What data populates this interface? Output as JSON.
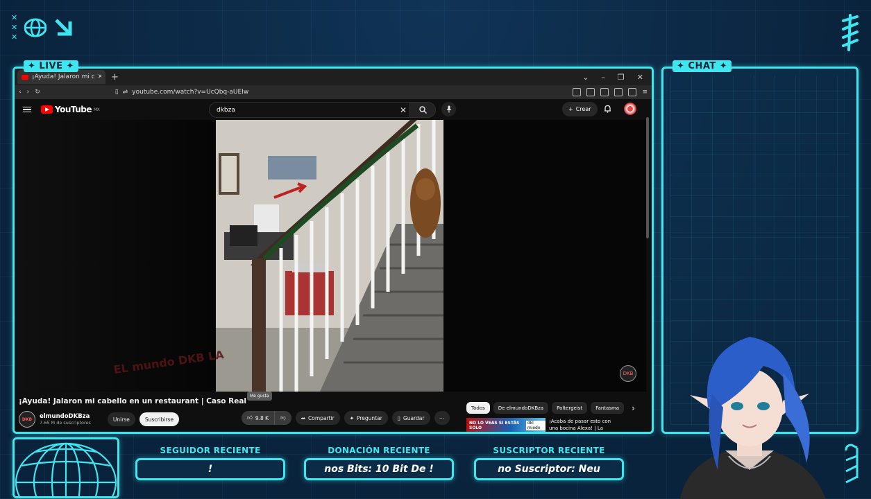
{
  "overlay": {
    "live_label": "✦ LIVE ✦",
    "chat_label": "✦ CHAT ✦",
    "accent": "#3ee6f0",
    "stats": [
      {
        "label": "SEGUIDOR RECIENTE",
        "value": "!"
      },
      {
        "label": "DONACIÓN RECIENTE",
        "value": "nos Bits: 10 Bit De !"
      },
      {
        "label": "SUSCRIPTOR RECIENTE",
        "value": "no Suscriptor: Neu"
      }
    ]
  },
  "browser": {
    "tab_title": "¡Ayuda! Jalaron mi cabello en",
    "new_tab": "+",
    "url": "youtube.com/watch?v=UcQbq-aUEIw",
    "window_controls": [
      "⌄",
      "–",
      "❐",
      "✕"
    ]
  },
  "youtube": {
    "logo": "YouTube",
    "region": "MX",
    "search_value": "dkbza",
    "create_label": "Crear",
    "video_title": "¡Ayuda! Jalaron mi cabello en un restaurant | Caso Real",
    "tooltip": "Me gusta",
    "watermark": "EL mundo DKB LA",
    "badge": "DKB",
    "channel": {
      "name": "elmundoDKBza",
      "subscribers": "7.65 M de suscriptores",
      "avatar_text": "DKB"
    },
    "buttons": {
      "join": "Unirse",
      "subscribe": "Suscribirse",
      "likes": "9.8 K",
      "share": "Compartir",
      "ask": "Preguntar",
      "save": "Guardar",
      "more": "⋯"
    },
    "chips": [
      "Todos",
      "De elmundoDKBza",
      "Poltergeist",
      "Fantasma"
    ],
    "recommendation": {
      "thumb_text": "NO LO VEAS SI ESTÁS SOLO",
      "thumb_tag": "dkl miedo",
      "title": "¡Acaba de pasar esto con una bocina Alexa! | La"
    }
  }
}
